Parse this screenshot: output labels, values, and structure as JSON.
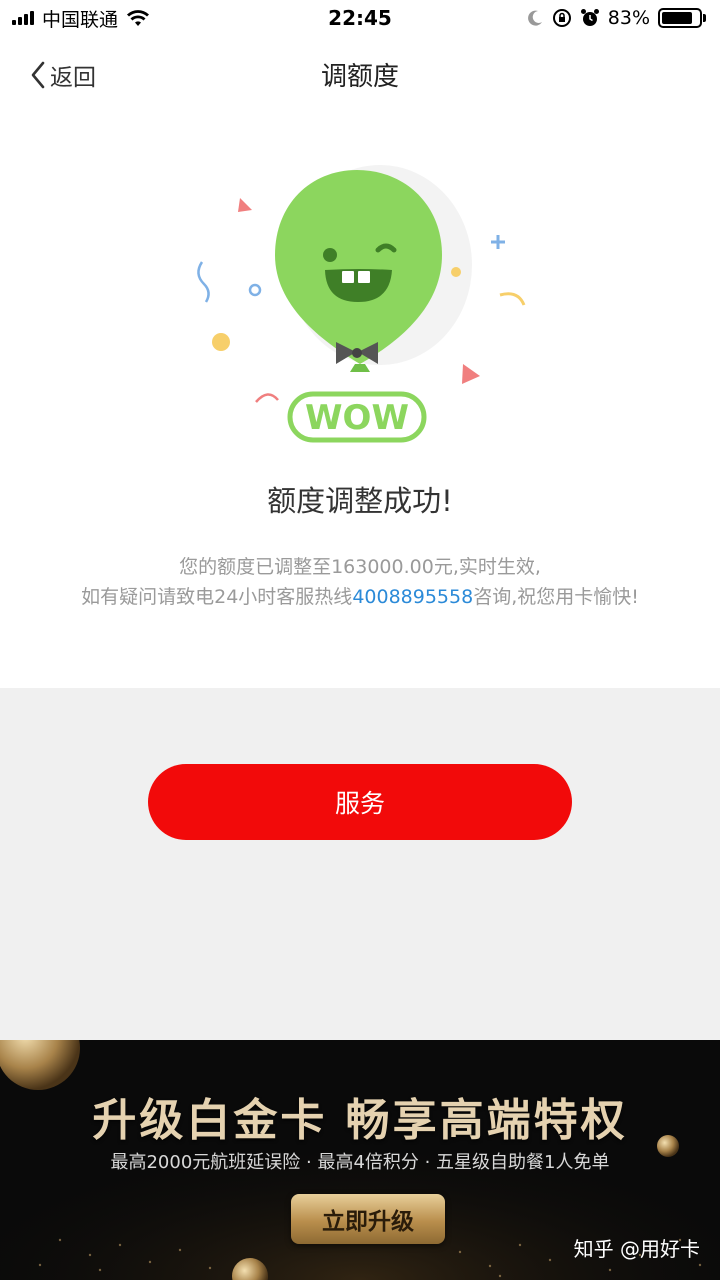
{
  "status_bar": {
    "carrier": "中国联通",
    "time": "22:45",
    "battery_percent": "83%",
    "battery_level": 0.83
  },
  "nav": {
    "back_label": "返回",
    "title": "调额度"
  },
  "illustration": {
    "badge_text": "WOW"
  },
  "result": {
    "title": "额度调整成功!",
    "line1": "您的额度已调整至163000.00元,实时生效,",
    "line2_prefix": "如有疑问请致电24小时客服热线",
    "hotline": "4008895558",
    "line2_suffix": "咨询,祝您用卡愉快!"
  },
  "service_button": "服务",
  "banner": {
    "title": "升级白金卡 畅享高端特权",
    "subtitle": "最高2000元航班延误险 · 最高4倍积分 · 五星级自助餐1人免单",
    "button": "立即升级",
    "watermark": "知乎 @用好卡"
  },
  "colors": {
    "accent_red": "#f20a0a",
    "hotline_blue": "#2b8ad8",
    "balloon_green": "#8cd65e",
    "gold": "#c9a46a"
  }
}
